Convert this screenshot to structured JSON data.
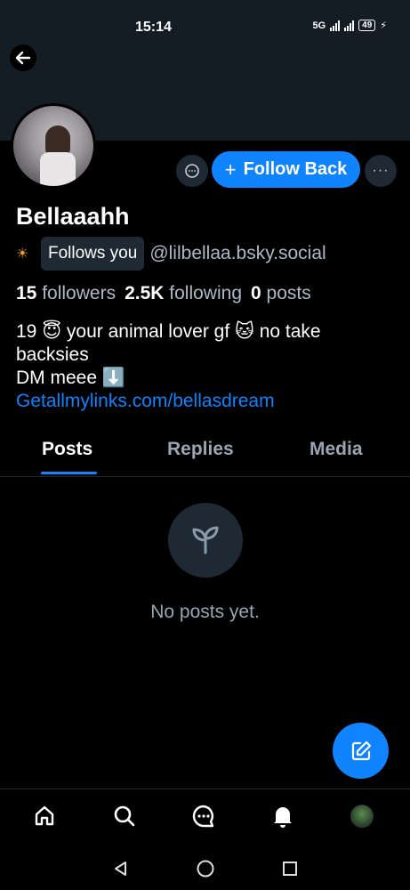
{
  "status_bar": {
    "time": "15:14",
    "network": "5G",
    "battery": "49"
  },
  "profile": {
    "display_name": "Bellaaahh",
    "follow_button_label": "Follow Back",
    "follows_you_badge": "Follows you",
    "handle": "@lilbellaa.bsky.social",
    "stats": {
      "followers_count": "15",
      "followers_label": "followers",
      "following_count": "2.5K",
      "following_label": "following",
      "posts_count": "0",
      "posts_label": "posts"
    },
    "bio": {
      "line1": "19 😇 your animal lover gf 🐱 no take backsies",
      "line2": "DM meee ⬇️",
      "link": "Getallmylinks.com/bellasdream"
    }
  },
  "tabs": [
    {
      "label": "Posts",
      "active": true
    },
    {
      "label": "Replies",
      "active": false
    },
    {
      "label": "Media",
      "active": false
    }
  ],
  "feed": {
    "empty_message": "No posts yet."
  },
  "bottom_nav": [
    "home-icon",
    "search-icon",
    "chat-icon",
    "bell-icon",
    "avatar"
  ],
  "colors": {
    "accent": "#1083fe",
    "surface": "#1e2934",
    "muted": "#9aa5b1",
    "background": "#000000"
  }
}
